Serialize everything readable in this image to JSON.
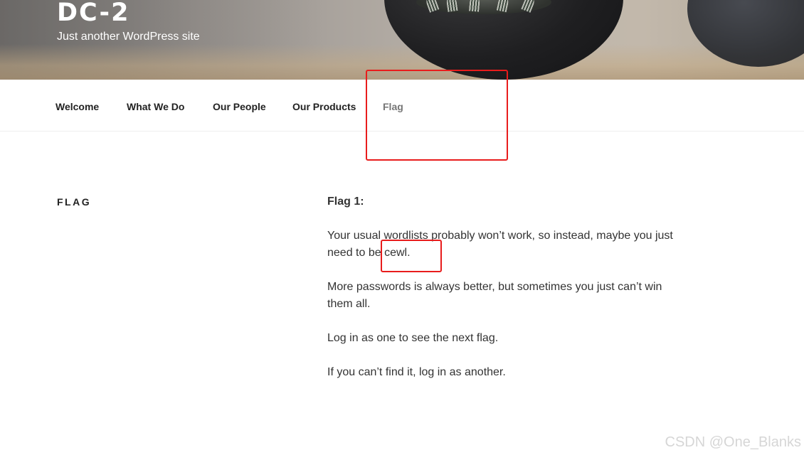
{
  "header": {
    "site_title": "DC-2",
    "tagline": "Just another WordPress site"
  },
  "nav": {
    "items": [
      {
        "label": "Welcome"
      },
      {
        "label": "What We Do"
      },
      {
        "label": "Our People"
      },
      {
        "label": "Our Products"
      },
      {
        "label": "Flag",
        "current": true
      }
    ]
  },
  "page": {
    "title": "FLAG",
    "heading": "Flag 1:",
    "paragraphs": [
      "Your usual wordlists probably won’t work, so instead, maybe you just need to be cewl.",
      "More passwords is always better, but sometimes you just can’t win them all.",
      "Log in as one to see the next flag.",
      "If you can’t find it, log in as another."
    ]
  },
  "annotations": {
    "color": "#e81c1c"
  },
  "watermark": {
    "text": "CSDN @One_Blanks"
  },
  "colors": {
    "nav_text": "#222222",
    "nav_current": "#767676",
    "body_text": "#333333"
  }
}
